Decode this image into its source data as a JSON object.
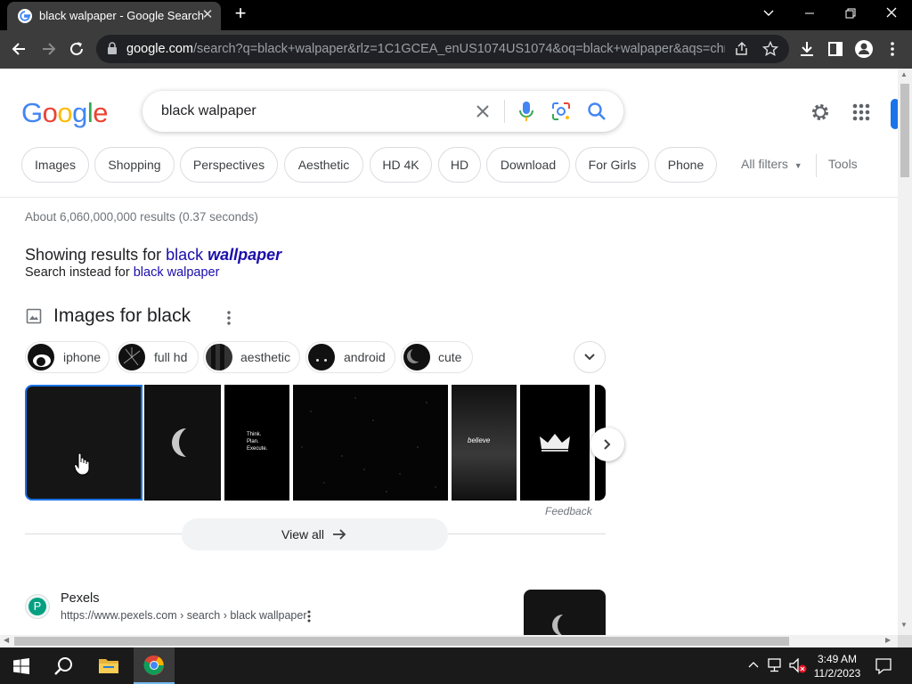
{
  "browser": {
    "tab_title": "black walpaper - Google Search",
    "url_host": "google.com",
    "url_rest": "/search?q=black+walpaper&rlz=1C1GCEA_enUS1074US1074&oq=black+walpaper&aqs=chro..."
  },
  "search": {
    "query": "black walpaper",
    "logo_letters": [
      "G",
      "o",
      "o",
      "g",
      "l",
      "e"
    ],
    "logo_colors": [
      "#4285f4",
      "#ea4335",
      "#fbbc05",
      "#4285f4",
      "#34a853",
      "#ea4335"
    ]
  },
  "filters": {
    "chips": [
      "Images",
      "Shopping",
      "Perspectives",
      "Aesthetic",
      "HD 4K",
      "HD",
      "Download",
      "For Girls",
      "Phone"
    ],
    "all_filters": "All filters",
    "tools": "Tools"
  },
  "results": {
    "stats": "About 6,060,000,000 results (0.37 seconds)",
    "showing_prefix": "Showing results for ",
    "showing_plain": "black ",
    "showing_bold": "wallpaper",
    "instead_prefix": "Search instead for ",
    "instead_link": "black walpaper"
  },
  "images": {
    "heading": "Images for black",
    "suggestions": [
      "iphone",
      "full hd",
      "aesthetic",
      "android",
      "cute"
    ],
    "thumb_text_1": "Think.\nPlan.\nExecute.",
    "thumb_text_2": "believe",
    "feedback": "Feedback",
    "view_all": "View all"
  },
  "result1": {
    "site": "Pexels",
    "letter": "P",
    "breadcrumb": "https://www.pexels.com › search › black wallpaper"
  },
  "taskbar": {
    "time": "3:49 AM",
    "date": "11/2/2023"
  },
  "colors": {
    "accent_blue": "#1a73e8",
    "link": "#1a0dab",
    "pexels": "#05a081"
  }
}
